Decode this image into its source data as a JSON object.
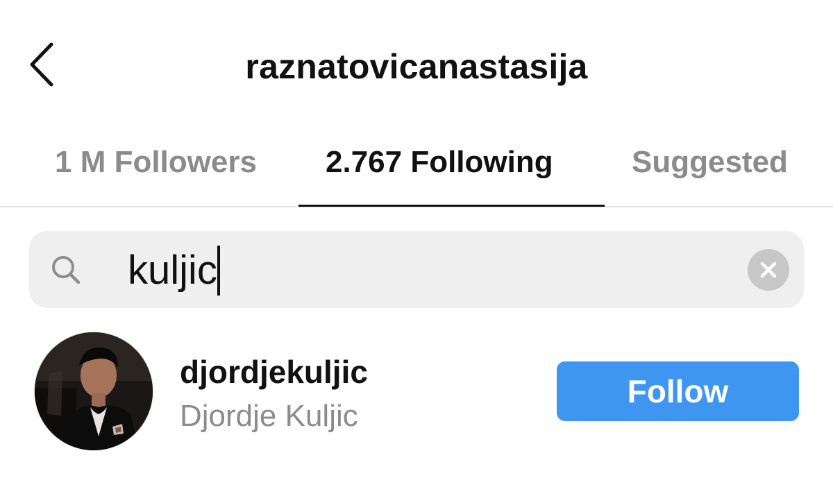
{
  "header": {
    "title": "raznatovicanastasija",
    "back_icon": "chevron-left-icon"
  },
  "tabs": [
    {
      "label": "1 M Followers",
      "active": false
    },
    {
      "label": "2.767 Following",
      "active": true
    },
    {
      "label": "Suggested",
      "active": false
    }
  ],
  "search": {
    "value": "kuljic",
    "icon": "search-icon",
    "clear_icon": "clear-icon"
  },
  "results": [
    {
      "username": "djordjekuljic",
      "full_name": "Djordje Kuljic",
      "button_label": "Follow"
    }
  ],
  "colors": {
    "accent": "#3e96f1",
    "text_primary": "#111111",
    "text_secondary": "#8b8b8b",
    "search_bg": "#efefef",
    "divider": "#e3e3e3"
  }
}
